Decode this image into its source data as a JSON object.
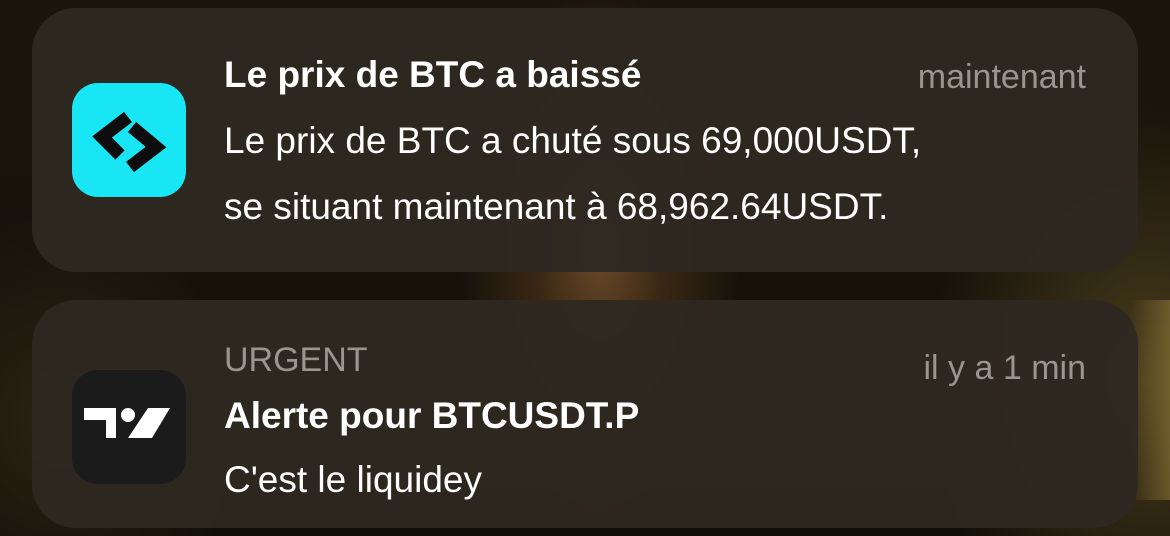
{
  "notifications": [
    {
      "app_icon": "bitget-logo-icon",
      "icon_color": "#19e6f4",
      "title": "Le prix de BTC a baissé",
      "time": "maintenant",
      "body_line1": "Le prix de BTC a chuté sous 69,000USDT,",
      "body_line2": "se situant maintenant à 68,962.64USDT."
    },
    {
      "app_icon": "tradingview-logo-icon",
      "icon_color": "#1b1b1b",
      "label": "URGENT",
      "time": "il y a 1 min",
      "title": "Alerte pour BTCUSDT.P",
      "body": "C'est le liquidey"
    }
  ]
}
